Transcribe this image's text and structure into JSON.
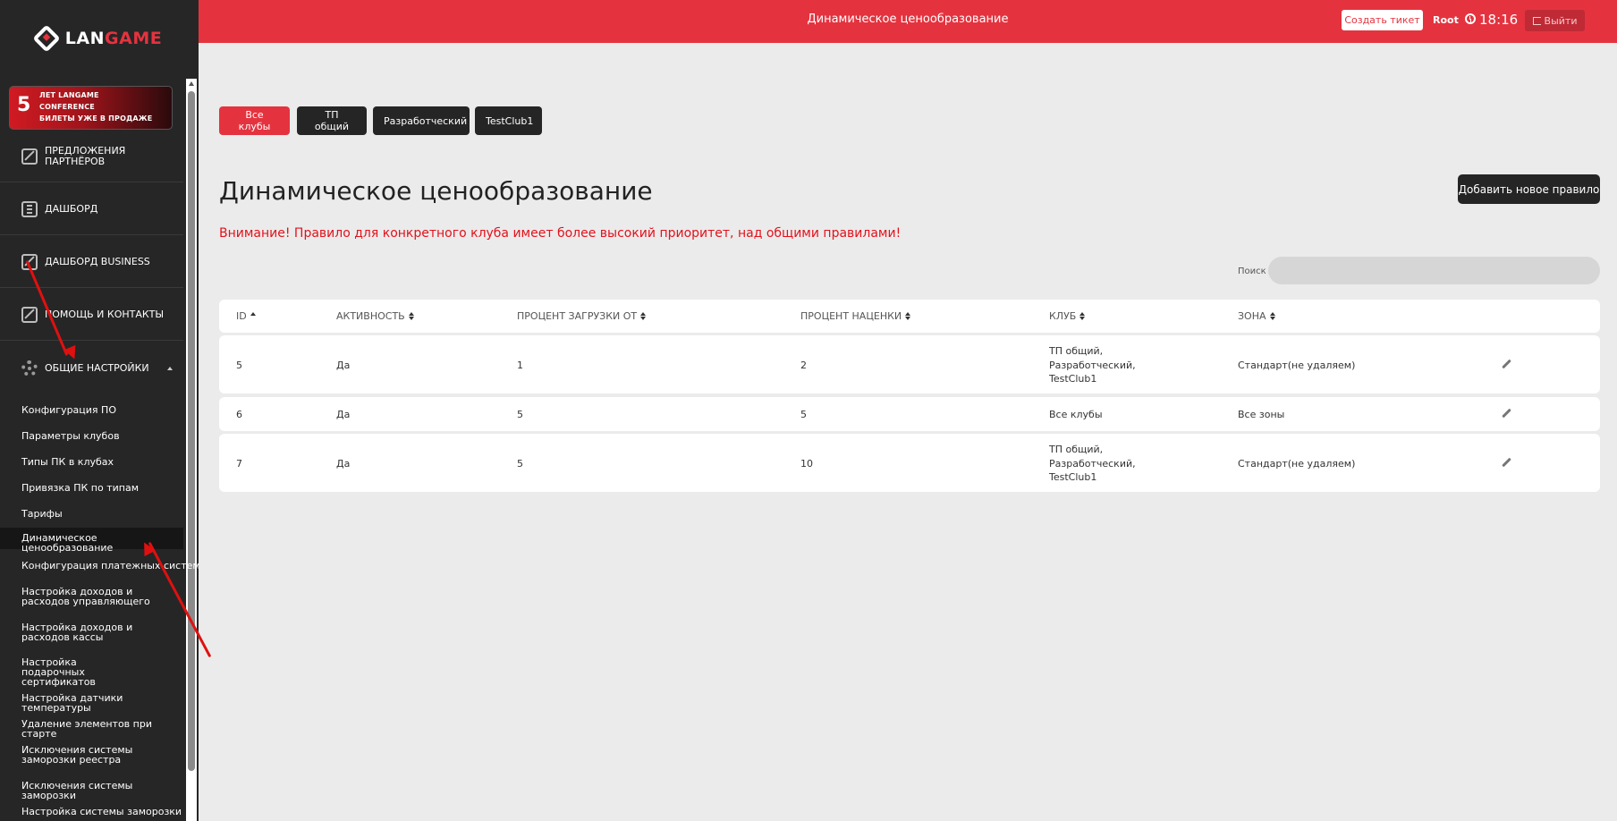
{
  "logo": {
    "part1": "LAN",
    "part2": "GAME"
  },
  "banner": {
    "number": "5",
    "line1": "ЛЕТ LANGAME",
    "line2": "CONFERENCE",
    "line3": "БИЛЕТЫ УЖЕ В ПРОДАЖЕ"
  },
  "sidebar": {
    "nav": [
      {
        "label": "ПРЕДЛОЖЕНИЯ ПАРТНЁРОВ",
        "icon": "edit-icon"
      },
      {
        "label": "ДАШБОРД",
        "icon": "document-icon"
      },
      {
        "label": "ДАШБОРД BUSINESS",
        "icon": "edit-icon"
      },
      {
        "label": "ПОМОЩЬ И КОНТАКТЫ",
        "icon": "edit-icon"
      },
      {
        "label": "ОБЩИЕ НАСТРОЙКИ",
        "icon": "gear-icon"
      }
    ],
    "sub": [
      "Конфигурация ПО",
      "Параметры клубов",
      "Типы ПК в клубах",
      "Привязка ПК по типам",
      "Тарифы",
      "Динамическое ценообразование",
      "Конфигурация платежных систем",
      "Настройка доходов и расходов управляющего",
      "Настройка доходов и расходов кассы",
      "Настройка подарочных сертификатов",
      "Настройка датчики температуры",
      "Удаление элементов при старте",
      "Исключения системы заморозки реестра",
      "Исключения системы заморозки",
      "Настройка системы заморозки"
    ],
    "active_sub": "Динамическое ценообразование"
  },
  "header": {
    "title": "Динамическое ценообразование",
    "ticket_label": "Создать тикет",
    "user": "Root",
    "time": "18:16",
    "logout_label": "Выйти"
  },
  "filters": [
    "Все клубы",
    "ТП общий",
    "Разработческий",
    "TestClub1"
  ],
  "active_filter": "Все клубы",
  "main": {
    "title": "Динамическое ценообразование",
    "add_label": "Добавить новое правило",
    "warning": "Внимание! Правило для конкретного клуба имеет более высокий приоритет, над общими правилами!",
    "search_label": "Поиск",
    "search_placeholder": ""
  },
  "table": {
    "headers": [
      "ID",
      "АКТИВНОСТЬ",
      "ПРОЦЕНТ ЗАГРУЗКИ ОТ",
      "ПРОЦЕНТ НАЦЕНКИ",
      "КЛУБ",
      "ЗОНА"
    ],
    "rows": [
      {
        "id": "5",
        "active": "Да",
        "load": "1",
        "markup": "2",
        "club_lines": [
          "ТП общий,",
          "Разработческий,",
          "TestClub1"
        ],
        "zone": "Стандарт(не удаляем)"
      },
      {
        "id": "6",
        "active": "Да",
        "load": "5",
        "markup": "5",
        "club_lines": [
          "Все клубы"
        ],
        "zone": "Все зоны"
      },
      {
        "id": "7",
        "active": "Да",
        "load": "5",
        "markup": "10",
        "club_lines": [
          "ТП общий,",
          "Разработческий,",
          "TestClub1"
        ],
        "zone": "Стандарт(не удаляем)"
      }
    ]
  },
  "colors": {
    "accent": "#e4333f",
    "sidebar": "#262626",
    "warning": "#e4111b"
  }
}
